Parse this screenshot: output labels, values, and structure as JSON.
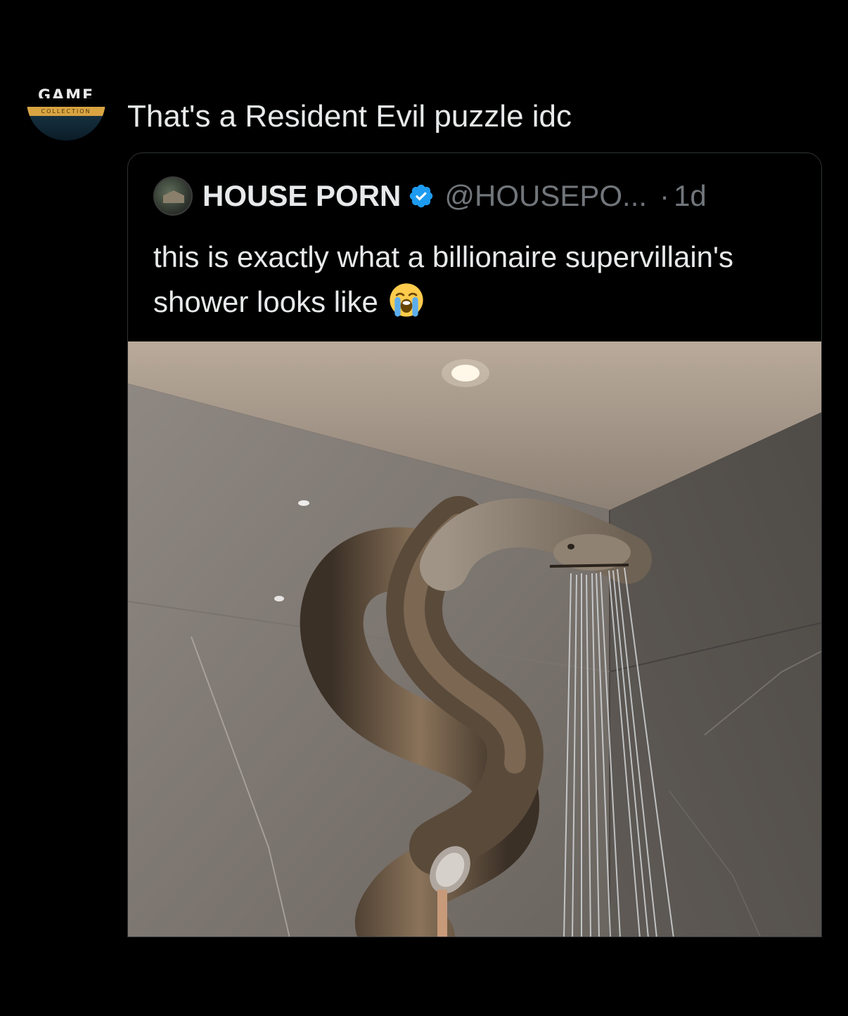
{
  "reply": {
    "avatar_logo_text": "GAME",
    "avatar_band_text": "COLLECTION",
    "text": "That's a Resident Evil puzzle idc"
  },
  "quote": {
    "name": "HOUSE PORN",
    "handle": "@HOUSEPO...",
    "separator": "·",
    "time": "1d",
    "text": "this is exactly what a billionaire supervillain's shower looks like",
    "emoji": "loudly-crying-face",
    "verified_color": "#1d9bf0"
  },
  "media": {
    "icon": "photo"
  },
  "colors": {
    "background": "#000000",
    "text_primary": "#e7e9ea",
    "text_secondary": "#71767b",
    "border": "#2f3336"
  }
}
